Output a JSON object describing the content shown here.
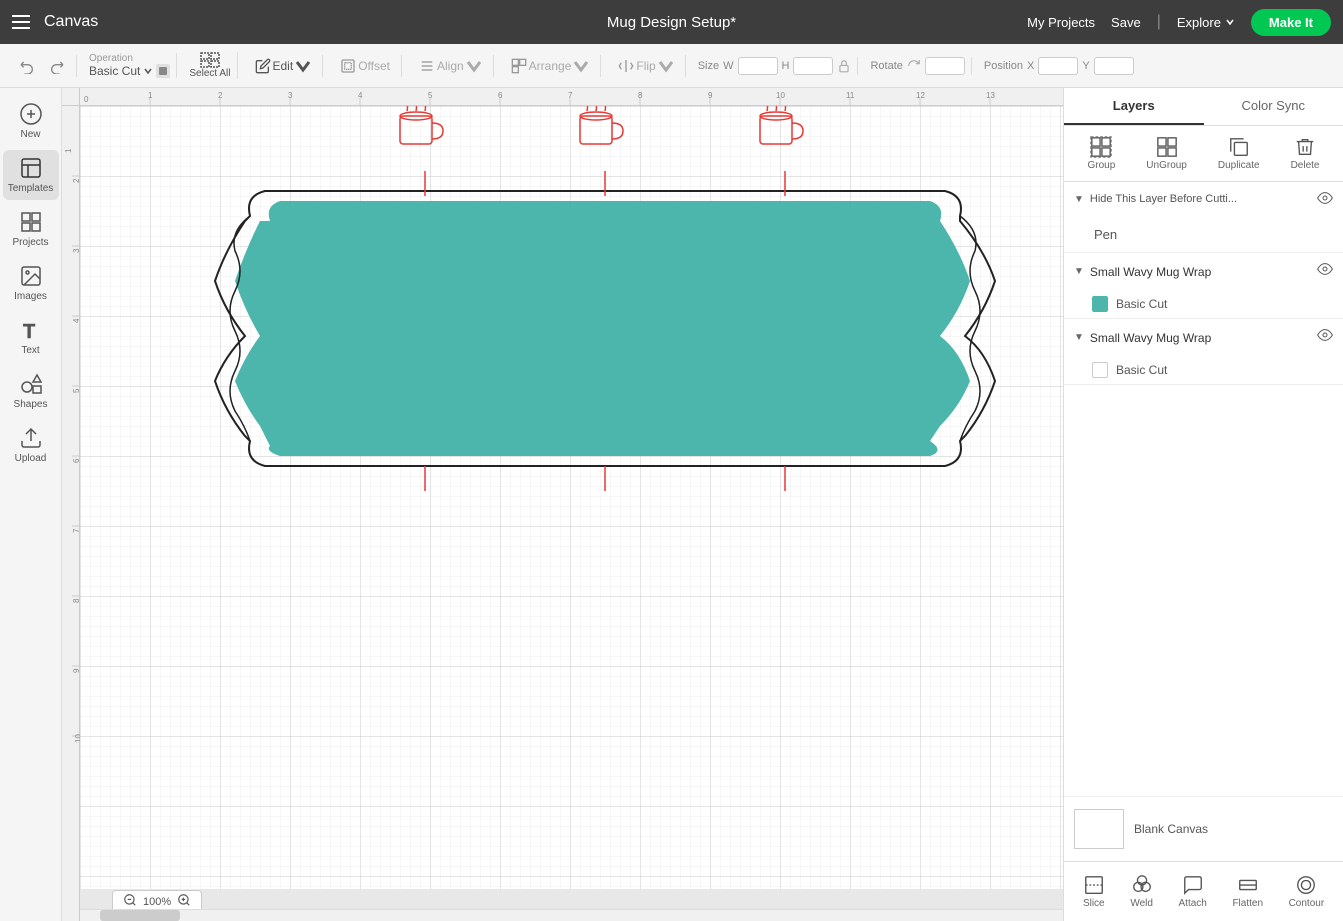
{
  "nav": {
    "hamburger_label": "menu",
    "logo": "Canvas",
    "title": "Mug Design Setup*",
    "my_projects": "My Projects",
    "save": "Save",
    "explore": "Explore",
    "make_it": "Make It"
  },
  "toolbar": {
    "operation_label": "Operation",
    "operation_value": "Basic Cut",
    "select_all": "Select All",
    "edit": "Edit",
    "offset": "Offset",
    "align": "Align",
    "arrange": "Arrange",
    "flip": "Flip",
    "size_label": "Size",
    "size_w": "W",
    "size_h": "H",
    "rotate_label": "Rotate",
    "position_label": "Position",
    "position_x": "X",
    "position_y": "Y"
  },
  "sidebar": {
    "items": [
      {
        "id": "new",
        "label": "New",
        "icon": "plus-circle"
      },
      {
        "id": "templates",
        "label": "Templates",
        "icon": "template"
      },
      {
        "id": "projects",
        "label": "Projects",
        "icon": "grid"
      },
      {
        "id": "images",
        "label": "Images",
        "icon": "image"
      },
      {
        "id": "text",
        "label": "Text",
        "icon": "text-t"
      },
      {
        "id": "shapes",
        "label": "Shapes",
        "icon": "shapes"
      },
      {
        "id": "upload",
        "label": "Upload",
        "icon": "upload"
      }
    ]
  },
  "canvas": {
    "zoom": "100%",
    "zoom_in": "+",
    "zoom_out": "-"
  },
  "layers": {
    "tab_layers": "Layers",
    "tab_color_sync": "Color Sync",
    "group_btn": "Group",
    "ungroup_btn": "UnGroup",
    "duplicate_btn": "Duplicate",
    "delete_btn": "Delete",
    "hide_layer_title": "Hide This Layer Before Cutti...",
    "pen_label": "Pen",
    "layer1": {
      "name": "Small Wavy Mug Wrap",
      "operation": "Basic Cut",
      "color": "#4db6ac"
    },
    "layer2": {
      "name": "Small Wavy Mug Wrap",
      "operation": "Basic Cut",
      "color": "#f0f0f0"
    },
    "blank_canvas": "Blank Canvas",
    "slice": "Slice",
    "weld": "Weld",
    "attach": "Attach",
    "flatten": "Flatten",
    "contour": "Contour"
  },
  "colors": {
    "teal": "#4db6ac",
    "green": "#00c853",
    "dark_nav": "#3d3d3d",
    "accent_red": "#e53935"
  }
}
